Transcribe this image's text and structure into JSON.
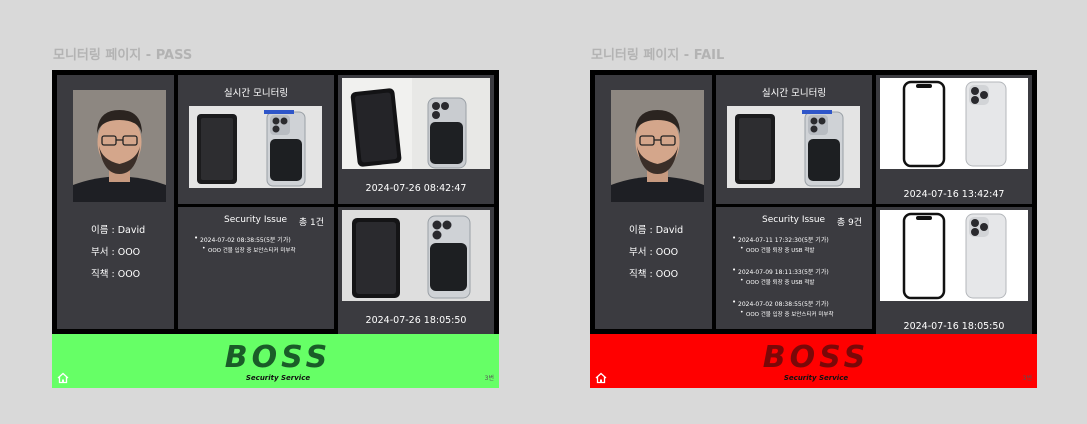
{
  "pass": {
    "page_label": "모니터링 페이지 - PASS",
    "profile": {
      "name": "이름 : David",
      "department": "부서 : OOO",
      "position": "직책 : OOO"
    },
    "monitor_title": "실시간 모니터링",
    "issue": {
      "title": "Security Issue",
      "count": "총 1건",
      "items": [
        {
          "date": "2024-07-02 08:38:55(5분 기가)",
          "desc": "OOO 건물 입장 중 보안스티커 미부착"
        }
      ]
    },
    "snapshots": [
      {
        "timestamp": "2024-07-26 08:42:47"
      },
      {
        "timestamp": "2024-07-26 18:05:50"
      }
    ],
    "footer": {
      "logo_main": "BOSS",
      "logo_sub": "Security Service",
      "page_num": "3번",
      "color": "#66ff66",
      "logo_color": "#1f6e2e"
    }
  },
  "fail": {
    "page_label": "모니터링 페이지 - FAIL",
    "profile": {
      "name": "이름 : David",
      "department": "부서 : OOO",
      "position": "직책 : OOO"
    },
    "monitor_title": "실시간 모니터링",
    "issue": {
      "title": "Security Issue",
      "count": "총 9건",
      "items": [
        {
          "date": "2024-07-11 17:32:30(5분 기가)",
          "desc": "OOO 건물 퇴장 중 USB 적발"
        },
        {
          "date": "2024-07-09 18:11:33(5분 기가)",
          "desc": "OOO 건물 퇴장 중 USB 적발"
        },
        {
          "date": "2024-07-02 08:38:55(5분 기가)",
          "desc": "OOO 건물 입장 중 보안스티커 미부착"
        }
      ]
    },
    "snapshots": [
      {
        "timestamp": "2024-07-16 13:42:47"
      },
      {
        "timestamp": "2024-07-16 18:05:50"
      }
    ],
    "footer": {
      "logo_main": "BOSS",
      "logo_sub": "Security Service",
      "page_num": "3번",
      "color": "#ff0000",
      "logo_color": "#8a0a0a"
    }
  },
  "icons": {
    "home": "home-icon"
  }
}
